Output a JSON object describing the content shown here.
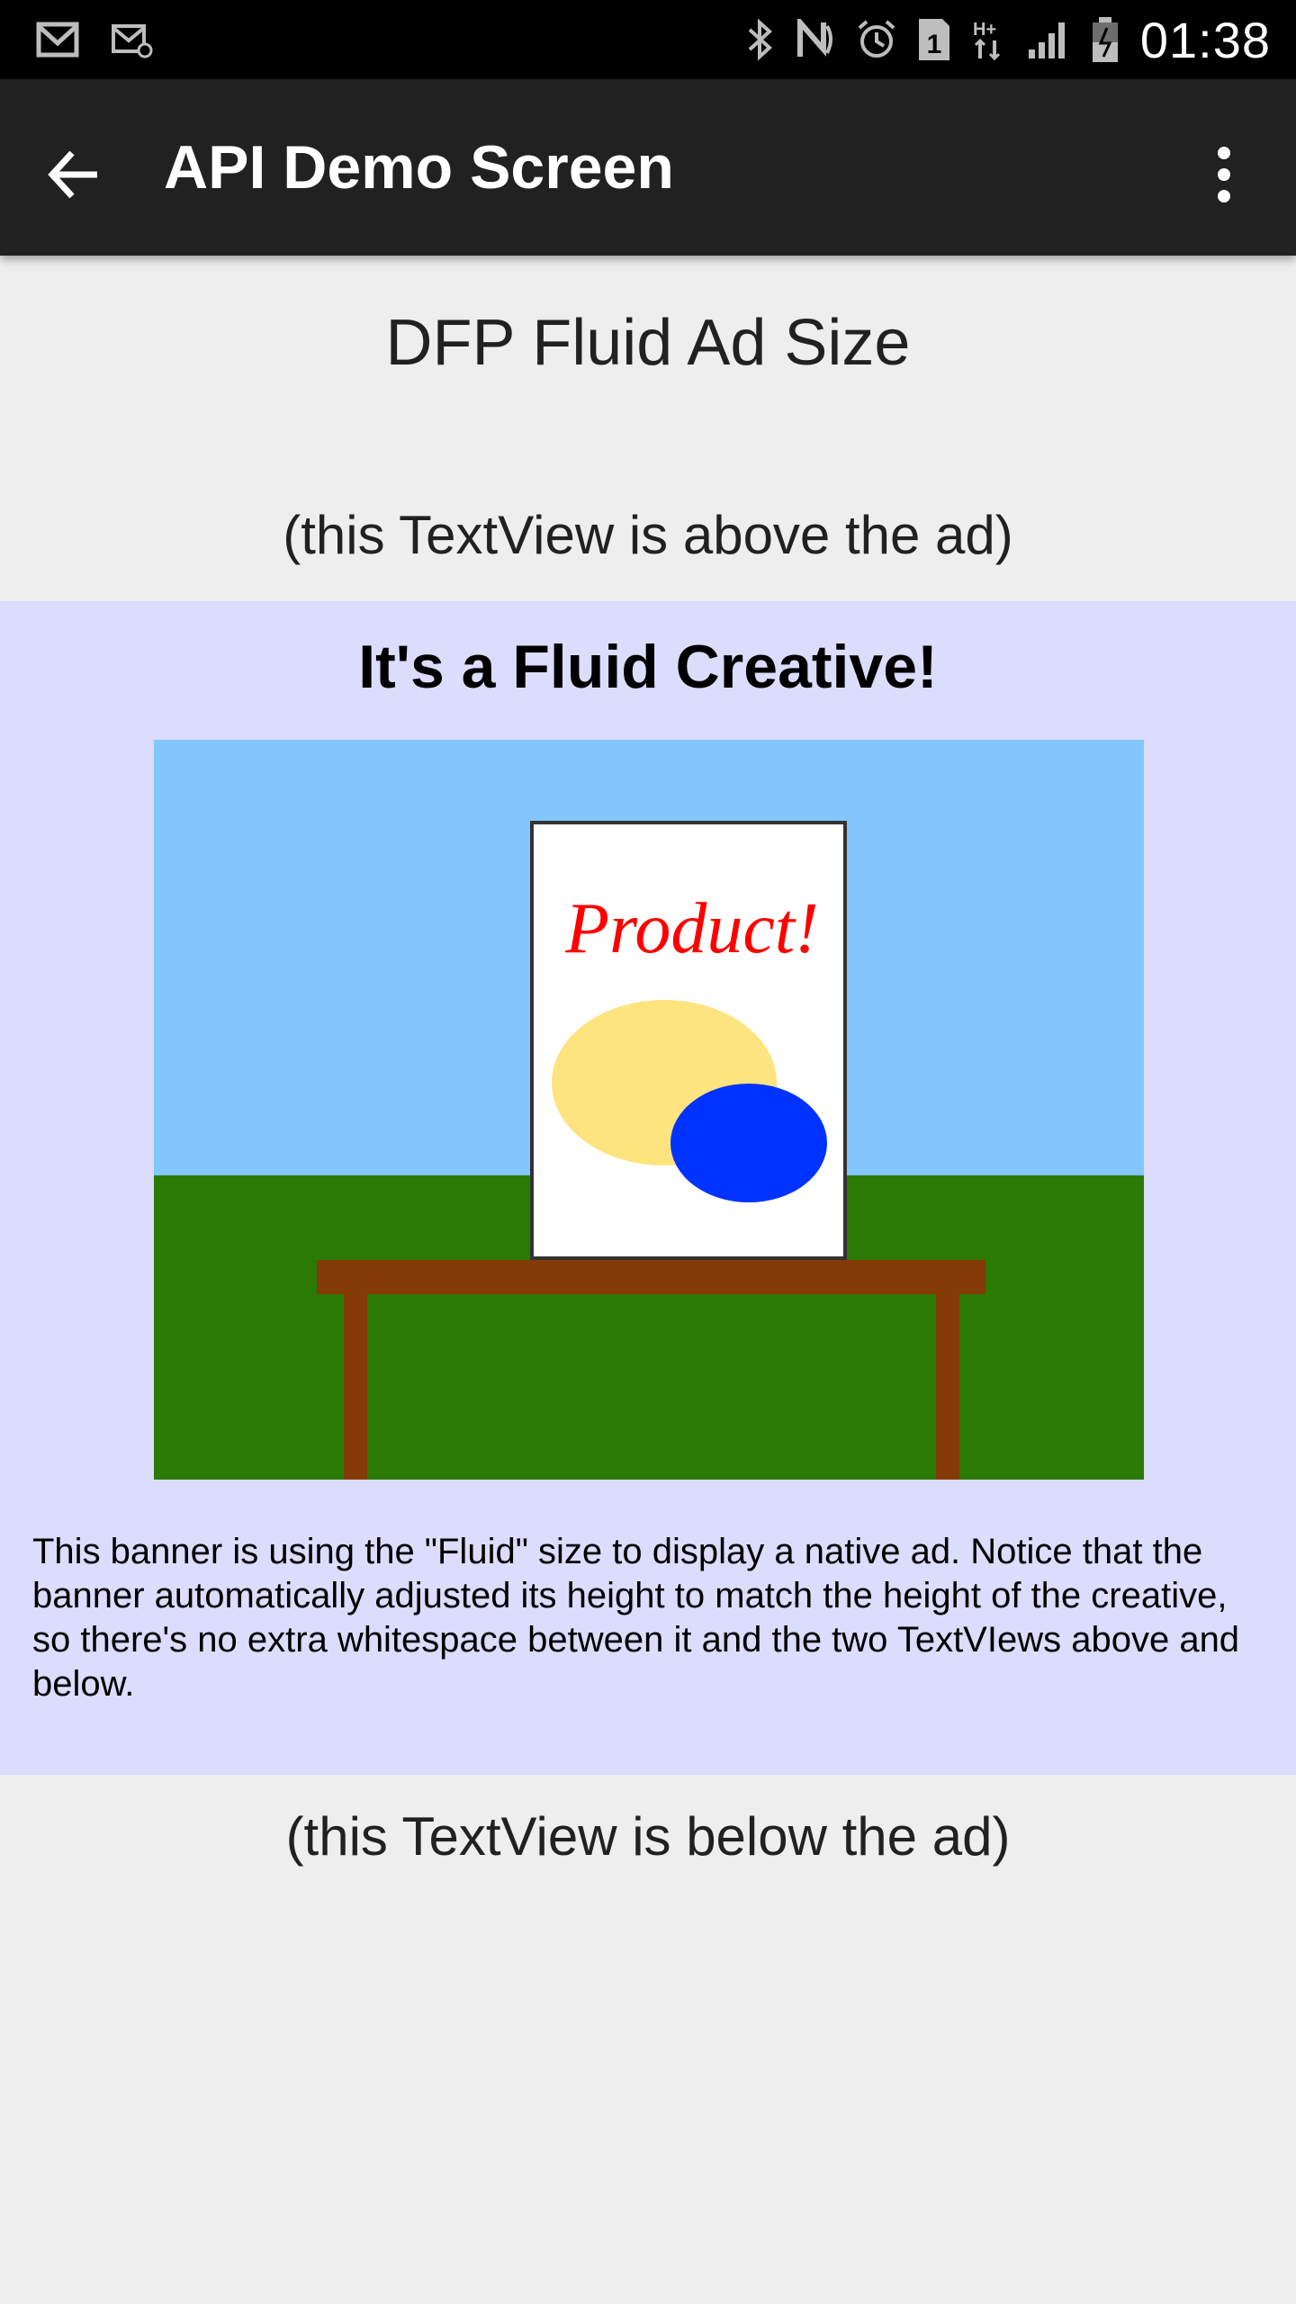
{
  "status_bar": {
    "time": "01:38",
    "network_label": "H+",
    "sim_label": "1",
    "left_icons": [
      "gmail-icon",
      "email-icon"
    ],
    "right_icons": [
      "bluetooth-icon",
      "nfc-icon",
      "alarm-icon",
      "sim-1-icon",
      "hplus-data-icon",
      "signal-icon",
      "battery-icon"
    ]
  },
  "toolbar": {
    "title": "API Demo Screen",
    "back_icon": "arrow-back-icon",
    "menu_icon": "more-vertical-icon"
  },
  "main": {
    "heading": "DFP Fluid Ad Size",
    "above_text": "(this TextView is above the ad)",
    "below_text": "(this TextView is below the ad)"
  },
  "ad": {
    "background": "#dcdcfd",
    "title": "It's a Fluid Creative!",
    "image_product_text": "Product!",
    "description": "This banner is using the \"Fluid\" size to display a native ad. Notice that the banner automatically adjusted its height to match the height of the creative, so there's no extra whitespace between it and the two TextVIews above and below.",
    "colors": {
      "sky": "#82c6fd",
      "grass": "#2a7a05",
      "table": "#843b07",
      "product_text": "#ff0000",
      "yellow_blob": "#fde47f",
      "blue_blob": "#0033ff"
    }
  }
}
